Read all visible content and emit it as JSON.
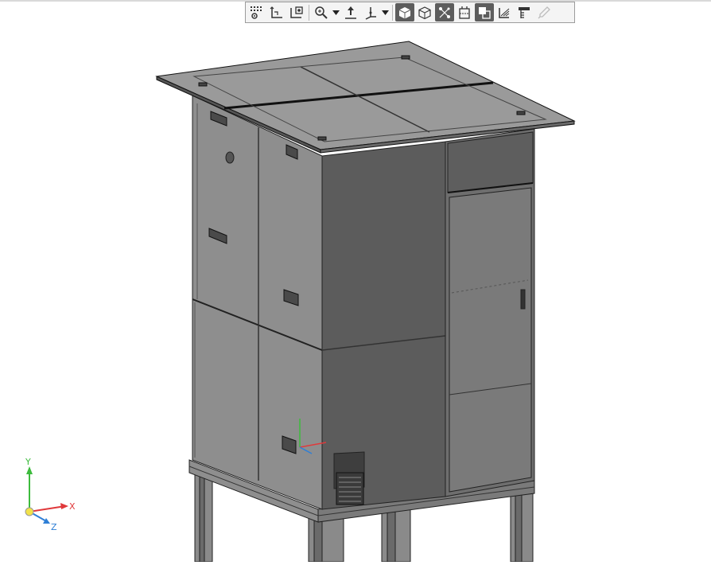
{
  "toolbar": {
    "buttons": [
      {
        "name": "settings-grid-icon",
        "state": "normal"
      },
      {
        "name": "ucs-icon",
        "state": "normal"
      },
      {
        "name": "named-views-icon",
        "state": "normal"
      },
      {
        "name": "zoom-icon",
        "state": "normal",
        "dropdown": true
      },
      {
        "name": "pan-icon",
        "state": "normal"
      },
      {
        "name": "orbit-icon",
        "state": "normal",
        "dropdown": true
      },
      {
        "name": "shaded-cube-icon",
        "state": "active"
      },
      {
        "name": "wireframe-cube-icon",
        "state": "normal"
      },
      {
        "name": "snap-icon",
        "state": "active"
      },
      {
        "name": "section-icon",
        "state": "normal"
      },
      {
        "name": "visibility-icon",
        "state": "active"
      },
      {
        "name": "layers-icon",
        "state": "normal"
      },
      {
        "name": "properties-icon",
        "state": "normal"
      },
      {
        "name": "pick-color-icon",
        "state": "disabled"
      }
    ]
  },
  "axes": {
    "x_label": "X",
    "y_label": "Y",
    "z_label": "Z"
  },
  "colors": {
    "x_axis": "#e0393b",
    "y_axis": "#3dbb3d",
    "z_axis": "#2f7fd6",
    "model_dark": "#5a5a5a",
    "model_mid": "#7a7a7a",
    "model_light": "#8e8e8e"
  }
}
